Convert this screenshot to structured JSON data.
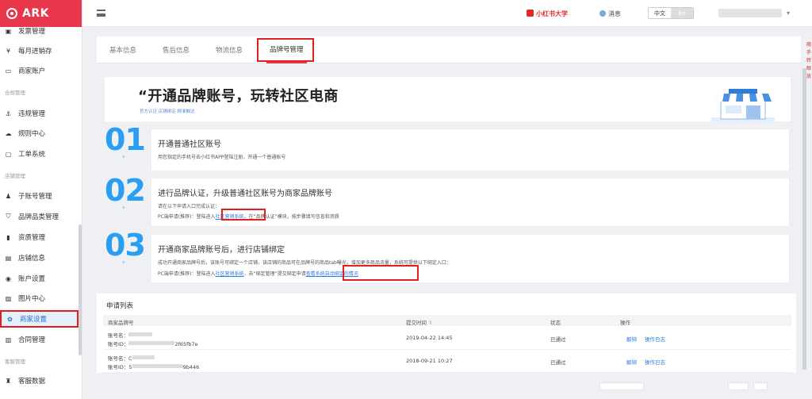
{
  "app": {
    "logo": "ARK"
  },
  "sidebar": {
    "items": [
      {
        "label": "发票管理",
        "icon": "invoice-icon",
        "glyph": "▣"
      },
      {
        "label": "每月进销存",
        "icon": "yen-icon",
        "glyph": "¥"
      },
      {
        "label": "商家账户",
        "icon": "card-icon",
        "glyph": "▭"
      },
      {
        "label": "合规管理",
        "section": true
      },
      {
        "label": "违规管理",
        "icon": "anchor-icon",
        "glyph": "⚓"
      },
      {
        "label": "规则中心",
        "icon": "cloud-icon",
        "glyph": "☁"
      },
      {
        "label": "工单系统",
        "icon": "ticket-icon",
        "glyph": "▢"
      },
      {
        "label": "店铺管理",
        "section": true
      },
      {
        "label": "子账号管理",
        "icon": "user-icon",
        "glyph": "♟"
      },
      {
        "label": "品牌品类管理",
        "icon": "tag-icon",
        "glyph": "⛉"
      },
      {
        "label": "资质管理",
        "icon": "bookmark-icon",
        "glyph": "▮"
      },
      {
        "label": "店铺信息",
        "icon": "store-info-icon",
        "glyph": "▤"
      },
      {
        "label": "账户设置",
        "icon": "account-icon",
        "glyph": "◉"
      },
      {
        "label": "图片中心",
        "icon": "image-icon",
        "glyph": "▨"
      },
      {
        "label": "商家设置",
        "icon": "gear-icon",
        "glyph": "✿",
        "active": true
      },
      {
        "label": "合同管理",
        "icon": "contract-icon",
        "glyph": "▥"
      },
      {
        "label": "客服管理",
        "section": true
      },
      {
        "label": "客服数据",
        "icon": "service-icon",
        "glyph": "♜"
      }
    ]
  },
  "topbar": {
    "brand_link": "小红书大学",
    "messages": "消息",
    "lang_active": "中文",
    "lang_other": "En"
  },
  "tabs": [
    "基本信息",
    "售后信息",
    "物流信息",
    "品牌号管理"
  ],
  "hero": {
    "title": "“开通品牌账号，玩转社区电商",
    "subtitle": "官方认证 店铺绑定 精准触达"
  },
  "steps": [
    {
      "number": "01",
      "title": "开通普通社区账号",
      "desc": "用您指定的手机号去小红书APP登陆注册，开通一个普通账号"
    },
    {
      "number": "02",
      "title": "进行品牌认证，升级普通社区账号为商家品牌账号",
      "line1": "请在以下申请入口完成认证：",
      "line2_prefix": "PC端申请(推荐)：登陆进入",
      "line2_link": "社区营销系统",
      "line2_suffix": "，在“品牌认证”模块，按步骤填写信息和资质"
    },
    {
      "number": "03",
      "title": "开通商家品牌账号后，进行店铺绑定",
      "line1": "成功开通商家品牌号后，该账号可绑定一个店铺，该店铺的商品可在品牌号的商品tab曝光，增加更多商品流量，系统可提供以下绑定入口：",
      "line2_prefix": "PC端申请(推荐)：登陆进入",
      "line2_link": "社区营销系统",
      "line2_mid": "，去“绑定管理”提交绑定申请",
      "line2_link2": "查看系统自动绑定的情况"
    }
  ],
  "apply_table": {
    "title": "申请列表",
    "columns": [
      "商家品牌号",
      "提交时间",
      "状态",
      "操作"
    ],
    "rows": [
      {
        "name_label": "账号名：",
        "id_label": "账号ID：",
        "id_visible": "2f65fb7e",
        "time": "2019-04-22 14:45",
        "status": "已通过",
        "ops": [
          "解绑",
          "操作日志"
        ]
      },
      {
        "name_label": "账号名：",
        "name_visible": "C",
        "id_label": "账号ID：",
        "id_visible_prefix": "5",
        "id_visible": "9b446",
        "time": "2018-09-21 10:27",
        "status": "已通过",
        "ops": [
          "解绑",
          "操作日志"
        ]
      }
    ]
  },
  "right_strip": [
    "随",
    "手",
    "转",
    "眼",
    "放"
  ],
  "colors": {
    "brand": "#e8374a",
    "accent": "#2b7be0",
    "step_number": "#2a9ff2",
    "highlight": "#e02020"
  }
}
